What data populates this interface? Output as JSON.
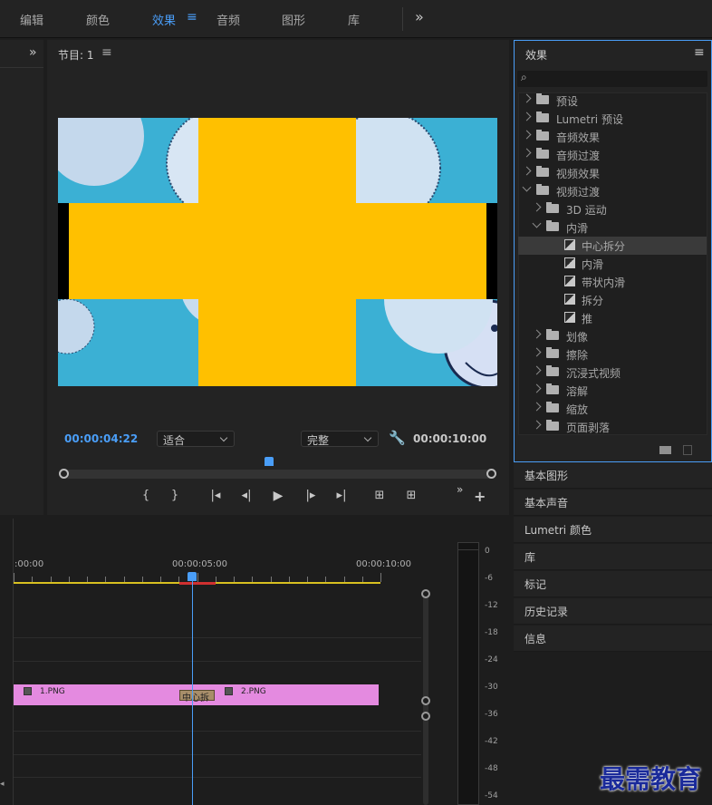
{
  "topbar": {
    "tabs": [
      "编辑",
      "颜色",
      "效果",
      "音频",
      "图形",
      "库"
    ],
    "more": "»"
  },
  "program_monitor": {
    "title": "节目: 1",
    "current_time": "00:00:04:22",
    "fit_select": "适合",
    "quality_select": "完整",
    "duration": "00:00:10:00"
  },
  "effects_panel": {
    "title": "效果",
    "search_placeholder": "",
    "tree": [
      {
        "label": "预设",
        "level": 0,
        "kind": "preset-folder",
        "expanded": false
      },
      {
        "label": "Lumetri 预设",
        "level": 0,
        "kind": "preset-folder",
        "expanded": false
      },
      {
        "label": "音频效果",
        "level": 0,
        "kind": "folder",
        "expanded": false
      },
      {
        "label": "音频过渡",
        "level": 0,
        "kind": "folder",
        "expanded": false
      },
      {
        "label": "视频效果",
        "level": 0,
        "kind": "folder",
        "expanded": false
      },
      {
        "label": "视频过渡",
        "level": 0,
        "kind": "folder",
        "expanded": true
      },
      {
        "label": "3D 运动",
        "level": 1,
        "kind": "folder",
        "expanded": false
      },
      {
        "label": "内滑",
        "level": 1,
        "kind": "folder",
        "expanded": true
      },
      {
        "label": "中心拆分",
        "level": 2,
        "kind": "effect",
        "selected": true
      },
      {
        "label": "内滑",
        "level": 2,
        "kind": "effect"
      },
      {
        "label": "带状内滑",
        "level": 2,
        "kind": "effect"
      },
      {
        "label": "拆分",
        "level": 2,
        "kind": "effect"
      },
      {
        "label": "推",
        "level": 2,
        "kind": "effect"
      },
      {
        "label": "划像",
        "level": 1,
        "kind": "folder",
        "expanded": false
      },
      {
        "label": "擦除",
        "level": 1,
        "kind": "folder",
        "expanded": false
      },
      {
        "label": "沉浸式视频",
        "level": 1,
        "kind": "folder",
        "expanded": false
      },
      {
        "label": "溶解",
        "level": 1,
        "kind": "folder",
        "expanded": false
      },
      {
        "label": "缩放",
        "level": 1,
        "kind": "folder",
        "expanded": false
      },
      {
        "label": "页面剥落",
        "level": 1,
        "kind": "folder",
        "expanded": false
      }
    ]
  },
  "stacked_panels": [
    "基本图形",
    "基本声音",
    "Lumetri 颜色",
    "库",
    "标记",
    "历史记录",
    "信息"
  ],
  "timeline": {
    "ruler_labels": [
      ":00:00",
      "00:00:05:00",
      "00:00:10:00"
    ],
    "clip1_label": "1.PNG",
    "clip2_label": "2.PNG",
    "transition_label": "中心拆",
    "clip_color": "#e48ae0"
  },
  "audio_meter": {
    "ticks": [
      "0",
      "-6",
      "-12",
      "-18",
      "-24",
      "-30",
      "-36",
      "-42",
      "-48",
      "-54"
    ]
  },
  "watermark": "最需教育",
  "colors": {
    "accent_blue": "#4a9ef8",
    "video_yellow": "#ffc000",
    "video_bg_blue": "#3bb0d4"
  }
}
